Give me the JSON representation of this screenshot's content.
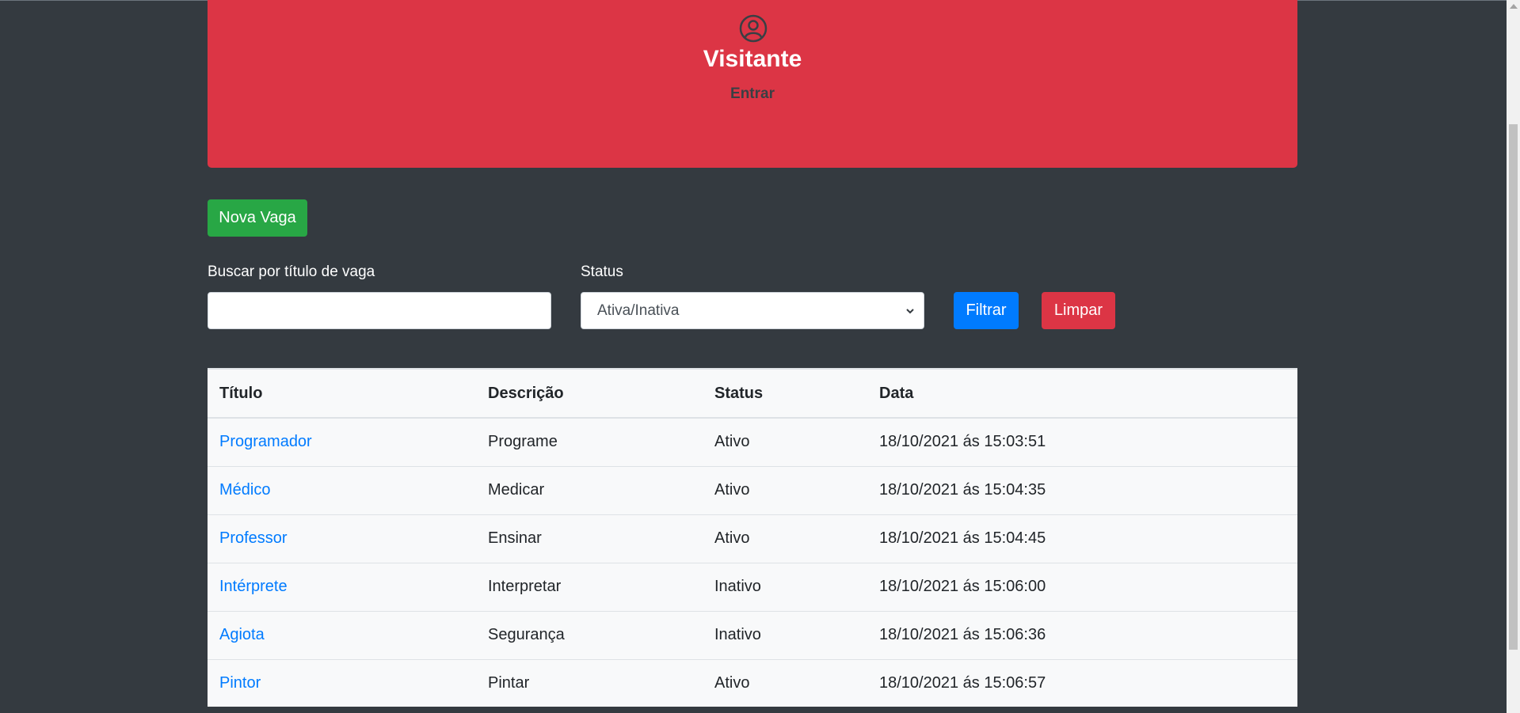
{
  "banner": {
    "user_name": "Visitante",
    "login_label": "Entrar",
    "icon": "user-circle-icon",
    "color": "#dc3545"
  },
  "toolbar": {
    "new_label": "Nova Vaga"
  },
  "filters": {
    "search_label": "Buscar por título de vaga",
    "search_value": "",
    "status_label": "Status",
    "status_selected": "Ativa/Inativa",
    "filter_label": "Filtrar",
    "clear_label": "Limpar"
  },
  "table": {
    "headers": [
      "Título",
      "Descrição",
      "Status",
      "Data"
    ],
    "rows": [
      {
        "title": "Programador",
        "description": "Programe",
        "status": "Ativo",
        "date": "18/10/2021 ás 15:03:51"
      },
      {
        "title": "Médico",
        "description": "Medicar",
        "status": "Ativo",
        "date": "18/10/2021 ás 15:04:35"
      },
      {
        "title": "Professor",
        "description": "Ensinar",
        "status": "Ativo",
        "date": "18/10/2021 ás 15:04:45"
      },
      {
        "title": "Intérprete",
        "description": "Interpretar",
        "status": "Inativo",
        "date": "18/10/2021 ás 15:06:00"
      },
      {
        "title": "Agiota",
        "description": "Segurança",
        "status": "Inativo",
        "date": "18/10/2021 ás 15:06:36"
      },
      {
        "title": "Pintor",
        "description": "Pintar",
        "status": "Ativo",
        "date": "18/10/2021 ás 15:06:57"
      }
    ]
  },
  "colors": {
    "background": "#343a40",
    "success": "#28a745",
    "primary": "#007bff",
    "danger": "#dc3545"
  }
}
